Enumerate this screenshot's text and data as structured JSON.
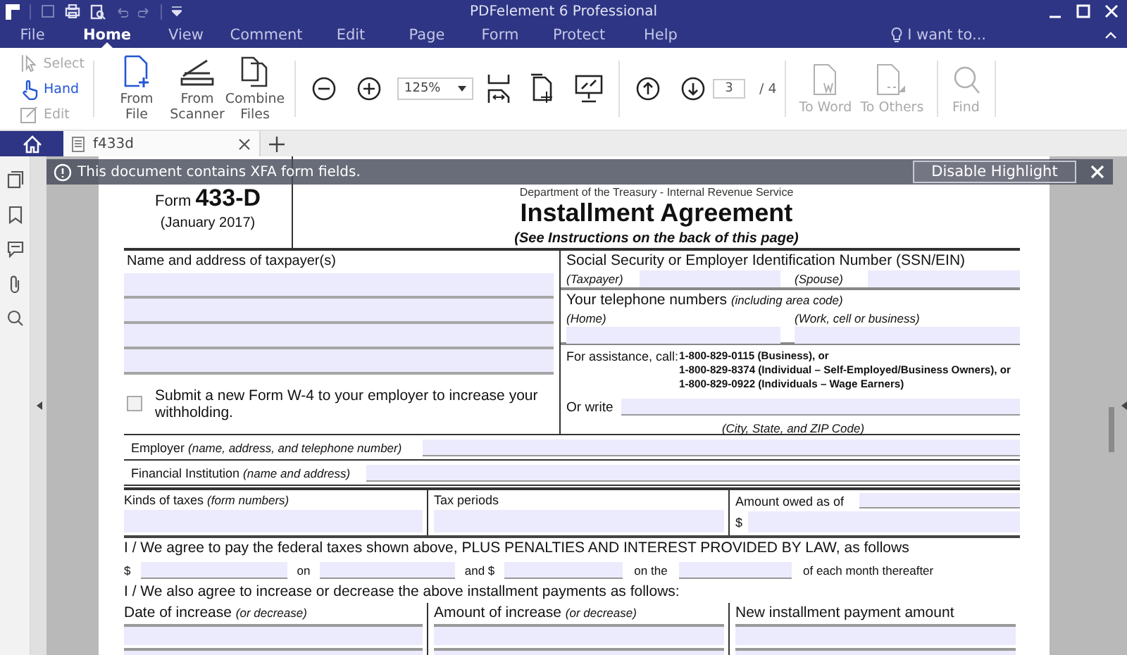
{
  "window": {
    "title": "PDFelement 6 Professional"
  },
  "menu": [
    {
      "label": "File",
      "selected": false
    },
    {
      "label": "Home",
      "selected": true
    },
    {
      "label": "View",
      "selected": false
    },
    {
      "label": "Comment",
      "selected": false
    },
    {
      "label": "Edit",
      "selected": false
    },
    {
      "label": "Page",
      "selected": false
    },
    {
      "label": "Form",
      "selected": false
    },
    {
      "label": "Protect",
      "selected": false
    },
    {
      "label": "Help",
      "selected": false
    }
  ],
  "assist": {
    "label": "I want to..."
  },
  "ribbon": {
    "modes": [
      {
        "kind": "select",
        "label": "Select",
        "disabled": true,
        "selected": false
      },
      {
        "kind": "hand",
        "label": "Hand",
        "disabled": false,
        "selected": true
      },
      {
        "kind": "edit",
        "label": "Edit",
        "disabled": true,
        "selected": false
      }
    ],
    "create": [
      {
        "kind": "file",
        "label": "From File"
      },
      {
        "kind": "scanner",
        "label": "From Scanner"
      },
      {
        "kind": "combine",
        "label": "Combine Files"
      }
    ],
    "zoom": "125%",
    "page": {
      "current": "3",
      "total": "/ 4"
    },
    "convert": [
      {
        "kind": "word",
        "label": "To Word",
        "disabled": true
      },
      {
        "kind": "others",
        "label": "To Others",
        "disabled": true
      },
      {
        "kind": "find",
        "label": "Find",
        "disabled": true
      }
    ]
  },
  "doc_tabs": [
    {
      "label": "f433d",
      "selected": true
    }
  ],
  "notice": {
    "text": "This document contains XFA form fields.",
    "button": "Disable Highlight"
  },
  "form": {
    "number": "Form **433-D**",
    "date": "(January 2017)",
    "agency": "Department of the Treasury - Internal Revenue Service",
    "title": "Installment Agreement",
    "subtitle": "(See Instructions on the back of this page)",
    "name_label": "Name and address of taxpayer(s)",
    "w4": {
      "text": "Submit a new Form W-4 to your employer to increase your withholding.",
      "checked": false
    },
    "ssn_label": "Social Security or Employer Identification Number (SSN/EIN)",
    "taxpayer": "(Taxpayer)",
    "spouse": "(Spouse)",
    "phone_label": "Your telephone numbers *(including area code)*",
    "home": "(Home)",
    "work": "(Work, cell or business)",
    "assist_label": "For assistance, call:",
    "assist_lines": [
      "1-800-829-0115 (Business), or",
      "1-800-829-8374 (Individual – Self-Employed/Business Owners), or",
      "1-800-829-0922 (Individuals – Wage Earners)"
    ],
    "write_label": "Or write",
    "address_hint": "(City, State, and ZIP Code)",
    "employer": "Employer *(name, address, and telephone number)*",
    "institution": "Financial Institution *(name and address)*",
    "kinds": "Kinds of taxes *(form numbers)*",
    "periods": "Tax periods",
    "owed": "Amount owed as of",
    "dollar": "$",
    "agree": "I / We agree to pay the federal taxes shown above, PLUS PENALTIES AND INTEREST PROVIDED BY LAW, as follows",
    "pay_row": [
      "$",
      "on",
      "and $",
      "on the",
      "of each month thereafter"
    ],
    "also": "I / We also agree to increase or decrease the above installment payments as follows:",
    "increase_cols": [
      "Date of increase *(or decrease)*",
      "Amount of increase *(or decrease)*",
      "New installment payment amount"
    ]
  }
}
